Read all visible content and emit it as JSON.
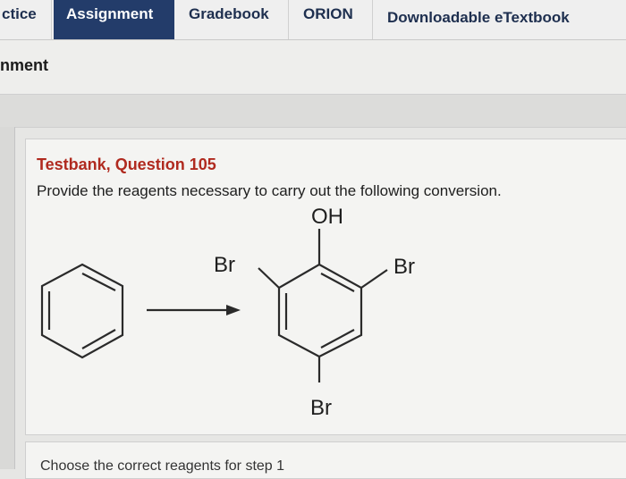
{
  "tabs": [
    {
      "label": "ctice",
      "active": false
    },
    {
      "label": "Assignment",
      "active": true
    },
    {
      "label": "Gradebook",
      "active": false
    },
    {
      "label": "ORION",
      "active": false
    },
    {
      "label": "Downloadable eTextbook",
      "active": false
    }
  ],
  "subheader": {
    "title": "nment"
  },
  "question": {
    "title": "Testbank, Question 105",
    "prompt": "Provide the reagents necessary to carry out the following conversion."
  },
  "molecule": {
    "labels": {
      "oh": "OH",
      "br_left": "Br",
      "br_right": "Br",
      "br_bottom": "Br"
    }
  },
  "step": {
    "label": "Choose the correct reagents for step 1"
  },
  "colors": {
    "active_tab": "#233c6a",
    "question_title": "#b02a1f"
  }
}
